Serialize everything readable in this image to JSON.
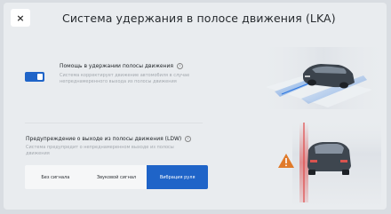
{
  "window": {
    "title": "Система удержания в полосе движения (LKA)",
    "close_icon": "close-icon",
    "close_glyph": "×"
  },
  "lka": {
    "label": "Помощь в удержании полосы движения",
    "info_glyph": "i",
    "description": "Система корректирует движение автомобиля в случае непреднамеренного выхода из полосы движения",
    "toggle_on": true
  },
  "ldw": {
    "label": "Предупреждение о выходе из полосы движения (LDW)",
    "info_glyph": "i",
    "description": "Система предупредит о непреднамеренном выходе из полосы движения",
    "options": [
      {
        "label": "Без сигнала"
      },
      {
        "label": "Звуковой сигнал"
      },
      {
        "label": "Вибрация руля"
      }
    ],
    "selected_index": 2
  },
  "colors": {
    "accent": "#1f64c8",
    "warning": "#e07a2a",
    "lane_alert": "#e04848"
  },
  "icons": [
    "close-icon",
    "info-icon",
    "warning-icon",
    "car-illustration"
  ]
}
